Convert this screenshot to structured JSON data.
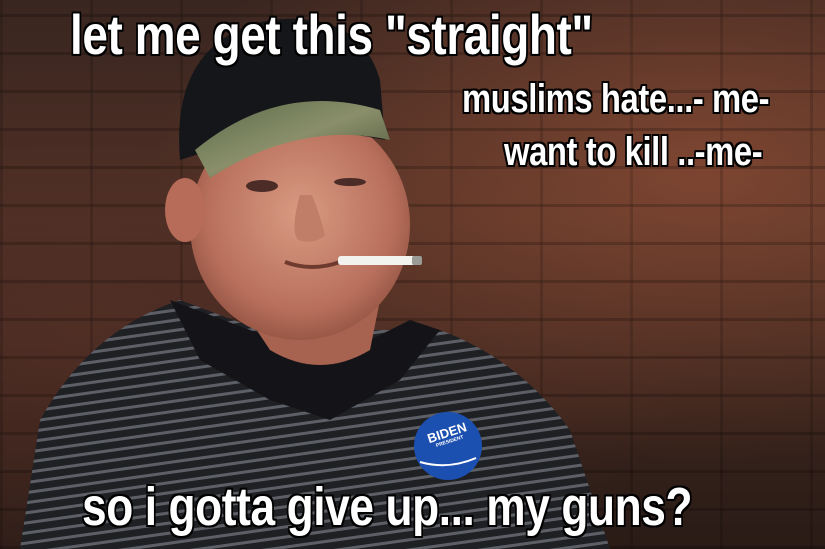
{
  "captions": {
    "top": "let me get this \"straight\"",
    "right_line1": "muslims hate...- me-",
    "right_line2": "want to kill ..-me-",
    "bottom": "so i gotta give up... my guns?"
  },
  "button": {
    "line1": "BIDEN",
    "line2": "PRESIDENT"
  }
}
